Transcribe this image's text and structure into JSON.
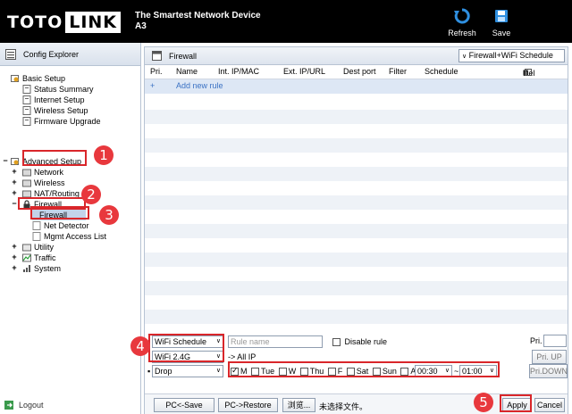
{
  "header": {
    "logo_left": "TOTO",
    "logo_right": "LINK",
    "tagline_line1": "The Smartest Network Device",
    "tagline_line2": "A3",
    "refresh_label": "Refresh",
    "save_label": "Save"
  },
  "sidebar": {
    "title": "Config Explorer",
    "basic_setup": "Basic Setup",
    "status_summary": "Status Summary",
    "internet_setup": "Internet Setup",
    "wireless_setup": "Wireless Setup",
    "firmware_upgrade": "Firmware Upgrade",
    "advanced_setup": "Advanced Setup",
    "network": "Network",
    "wireless": "Wireless",
    "nat_routing": "NAT/Routing",
    "firewall": "Firewall",
    "firewall_child": "Firewall",
    "net_detector": "Net Detector",
    "mgmt_access_list": "Mgmt Access List",
    "utility": "Utility",
    "traffic": "Traffic",
    "system": "System",
    "logout": "Logout"
  },
  "main": {
    "title": "Firewall",
    "mode_select": "Firewall+WiFi Schedule",
    "columns": {
      "pri": "Pri.",
      "name": "Name",
      "int_ip": "Int. IP/MAC",
      "ext_ip": "Ext. IP/URL",
      "dest_port": "Dest port",
      "filter": "Filter",
      "schedule": "Schedule",
      "del": "Del"
    },
    "add_symbol": "+",
    "add_new_rule": "Add new rule"
  },
  "editor": {
    "type_select": "WiFi Schedule",
    "rule_name_placeholder": "Rule name",
    "disable_rule": "Disable rule",
    "pri_label": "Pri.",
    "band_select": "WiFi 2.4G",
    "all_ip": "-> All IP",
    "action_select": "Drop",
    "days": {
      "mon": "M",
      "tue": "Tue",
      "wed": "W",
      "thu": "Thu",
      "fri": "F",
      "sat": "Sat",
      "sun": "Sun",
      "all": "All"
    },
    "time_from": "00:30",
    "tilde": "~",
    "time_to": "01:00",
    "pri_up": "Pri. UP",
    "pri_down": "Pri.DOWN"
  },
  "bottom": {
    "pc_save": "PC<-Save",
    "pc_restore": "PC->Restore",
    "browse": "浏览...",
    "no_file": "未选择文件。",
    "apply": "Apply",
    "cancel": "Cancel"
  },
  "badges": [
    "1",
    "2",
    "3",
    "4",
    "5"
  ],
  "colors": {
    "annotation_red": "#d9262a",
    "badge_red": "#e8383d",
    "accent_blue": "#3b72c4"
  }
}
